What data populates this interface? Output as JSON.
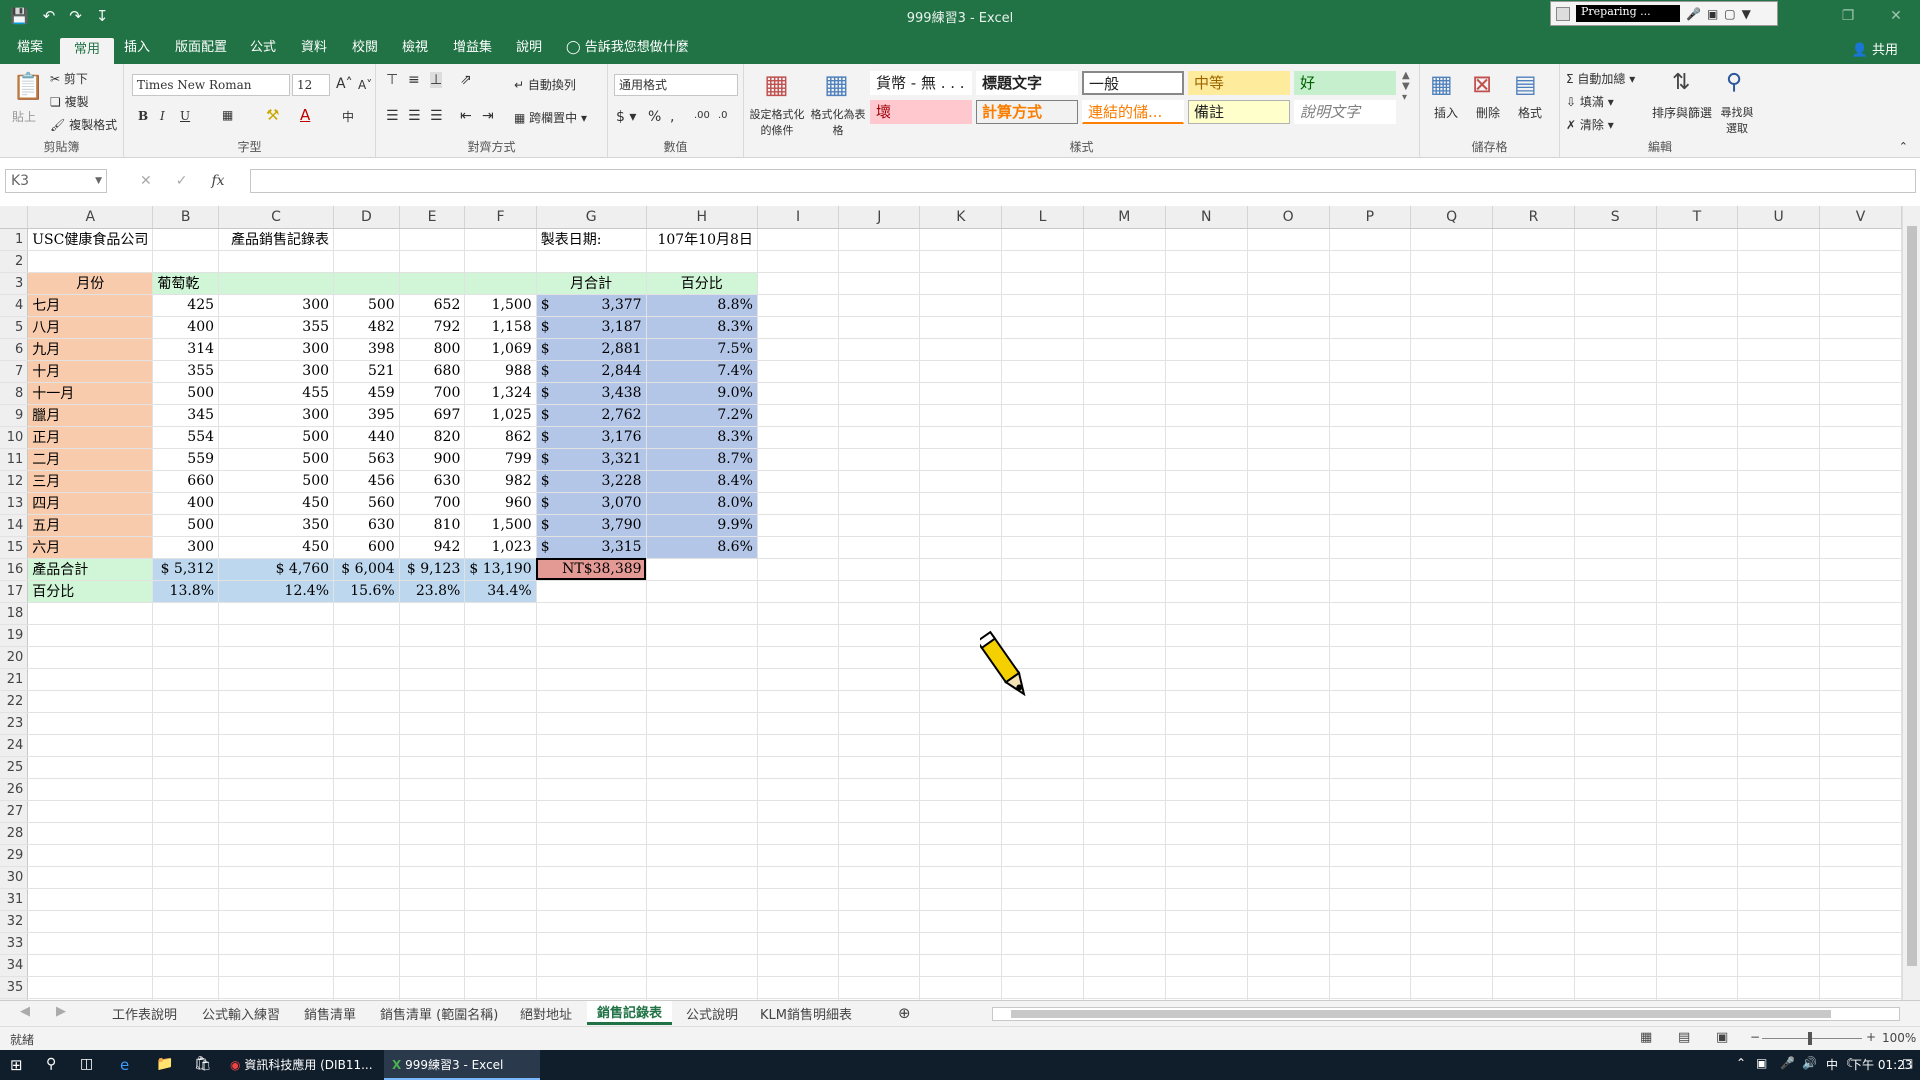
{
  "window": {
    "title": "999練習3 - Excel",
    "recorder_status": "Preparing ..."
  },
  "ribbon_tabs": [
    "檔案",
    "常用",
    "插入",
    "版面配置",
    "公式",
    "資料",
    "校閱",
    "檢視",
    "增益集",
    "說明"
  ],
  "active_tab": "常用",
  "tell_me": "告訴我您想做什麼",
  "share": "共用",
  "clipboard": {
    "cut": "剪下",
    "copy": "複製",
    "format_painter": "複製格式",
    "paste": "貼上",
    "label": "剪貼簿"
  },
  "font": {
    "name": "Times New Roman",
    "size": "12",
    "label": "字型"
  },
  "alignment": {
    "wrap": "自動換列",
    "merge": "跨欄置中",
    "label": "對齊方式"
  },
  "number": {
    "format": "通用格式",
    "label": "數值"
  },
  "styles": {
    "cond_format": "設定格式化的條件",
    "format_table": "格式化為表格",
    "cells": [
      "貨幣 - 無 . . .",
      "標題文字",
      "一般",
      "中等",
      "好",
      "壞",
      "計算方式",
      "連結的儲...",
      "備註",
      "說明文字"
    ],
    "label": "樣式"
  },
  "cells_group": {
    "insert": "插入",
    "delete": "刪除",
    "format": "格式",
    "label": "儲存格"
  },
  "editing": {
    "autosum": "自動加總",
    "fill": "填滿",
    "clear": "清除",
    "sort": "排序與篩選",
    "find": "尋找與選取",
    "label": "編輯"
  },
  "name_box": "K3",
  "columns": [
    "A",
    "B",
    "C",
    "D",
    "E",
    "F",
    "G",
    "H",
    "I",
    "J",
    "K",
    "L",
    "M",
    "N",
    "O",
    "P",
    "Q",
    "R",
    "S",
    "T",
    "U",
    "V"
  ],
  "sheet": {
    "company": "USC健康食品公司",
    "title": "產品銷售記錄表",
    "date_label": "製表日期:",
    "date_value": "107年10月8日",
    "header_month": "月份",
    "header_b": "葡萄乾",
    "header_total": "月合計",
    "header_pct": "百分比",
    "rows": [
      [
        "七月",
        "425",
        "300",
        "500",
        "652",
        "1,500",
        "$",
        "3,377",
        "8.8%"
      ],
      [
        "八月",
        "400",
        "355",
        "482",
        "792",
        "1,158",
        "$",
        "3,187",
        "8.3%"
      ],
      [
        "九月",
        "314",
        "300",
        "398",
        "800",
        "1,069",
        "$",
        "2,881",
        "7.5%"
      ],
      [
        "十月",
        "355",
        "300",
        "521",
        "680",
        "988",
        "$",
        "2,844",
        "7.4%"
      ],
      [
        "十一月",
        "500",
        "455",
        "459",
        "700",
        "1,324",
        "$",
        "3,438",
        "9.0%"
      ],
      [
        "臘月",
        "345",
        "300",
        "395",
        "697",
        "1,025",
        "$",
        "2,762",
        "7.2%"
      ],
      [
        "正月",
        "554",
        "500",
        "440",
        "820",
        "862",
        "$",
        "3,176",
        "8.3%"
      ],
      [
        "二月",
        "559",
        "500",
        "563",
        "900",
        "799",
        "$",
        "3,321",
        "8.7%"
      ],
      [
        "三月",
        "660",
        "500",
        "456",
        "630",
        "982",
        "$",
        "3,228",
        "8.4%"
      ],
      [
        "四月",
        "400",
        "450",
        "560",
        "700",
        "960",
        "$",
        "3,070",
        "8.0%"
      ],
      [
        "五月",
        "500",
        "350",
        "630",
        "810",
        "1,500",
        "$",
        "3,790",
        "9.9%"
      ],
      [
        "六月",
        "300",
        "450",
        "600",
        "942",
        "1,023",
        "$",
        "3,315",
        "8.6%"
      ]
    ],
    "total_label": "產品合計",
    "totals": [
      "$ 5,312",
      "$ 4,760",
      "$ 6,004",
      "$ 9,123",
      "$ 13,190"
    ],
    "grand_total": "NT$38,389",
    "pct_label": "百分比",
    "pcts": [
      "13.8%",
      "12.4%",
      "15.6%",
      "23.8%",
      "34.4%"
    ]
  },
  "sheet_tabs": [
    "工作表說明",
    "公式輸入練習",
    "銷售清單",
    "銷售清單 (範圍名稱)",
    "絕對地址",
    "銷售記錄表",
    "公式說明",
    "KLM銷售明細表"
  ],
  "active_sheet": "銷售記錄表",
  "status": {
    "ready": "就緒",
    "zoom": "100%"
  },
  "taskbar": {
    "chrome": "資訊科技應用 (DIB11...",
    "excel": "999練習3 - Excel",
    "ime": "中",
    "clock": "下午 01:23"
  }
}
